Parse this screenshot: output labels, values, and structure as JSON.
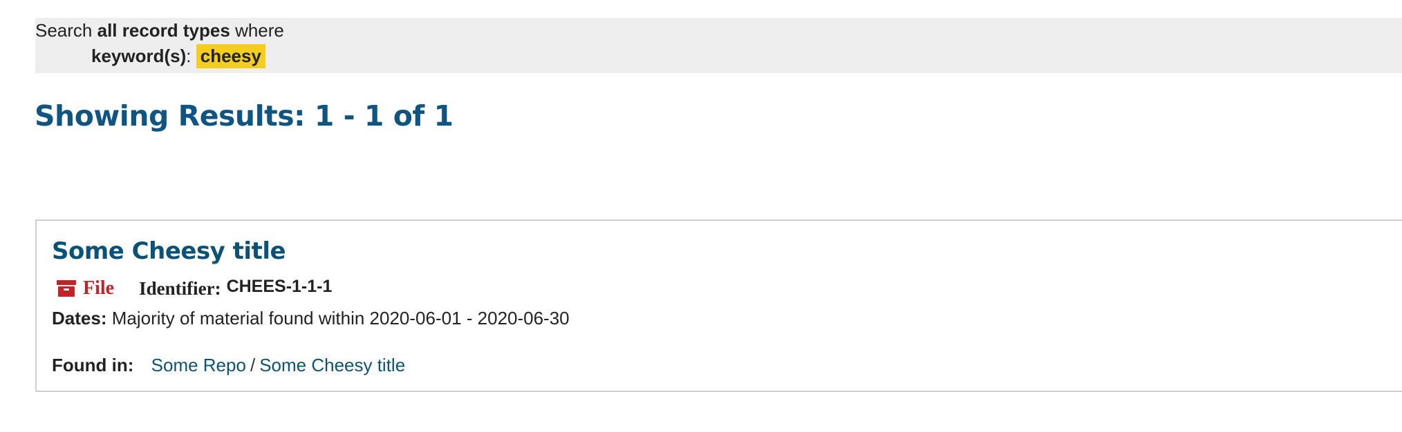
{
  "search_summary": {
    "prefix": "Search",
    "scope": "all record types",
    "suffix": "where",
    "field_label": "keyword(s)",
    "field_separator": ":",
    "keyword": "cheesy"
  },
  "results": {
    "heading": "Showing Results: 1 - 1 of 1"
  },
  "result_item": {
    "title": "Some Cheesy title",
    "type_icon": "archive-box-icon",
    "type_label": "File",
    "identifier_label": "Identifier:",
    "identifier_value": "CHEES-1-1-1",
    "dates_label": "Dates:",
    "dates_value": "Majority of material found within 2020-06-01 - 2020-06-30",
    "found_in_label": "Found in:",
    "found_in": [
      {
        "label": "Some Repo"
      },
      {
        "label": "Some Cheesy title"
      }
    ],
    "found_in_separator": "/"
  },
  "colors": {
    "heading_blue": "#0f5584",
    "link_blue": "#0b5278",
    "file_red": "#c62124",
    "highlight_yellow": "#f4cd1f",
    "summary_bg": "#eeeeee"
  }
}
